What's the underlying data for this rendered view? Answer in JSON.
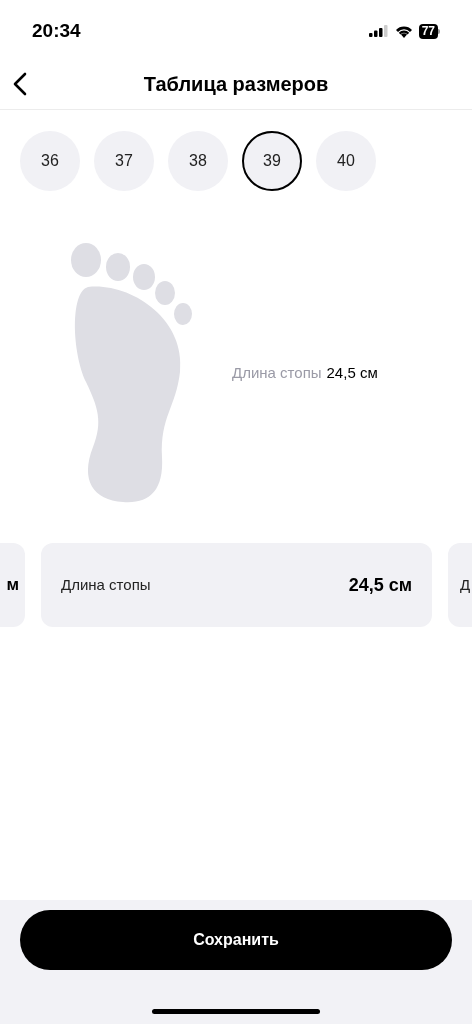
{
  "status_bar": {
    "time": "20:34",
    "battery": "77"
  },
  "header": {
    "title": "Таблица размеров"
  },
  "sizes": [
    {
      "label": "36",
      "selected": false
    },
    {
      "label": "37",
      "selected": false
    },
    {
      "label": "38",
      "selected": false
    },
    {
      "label": "39",
      "selected": true
    },
    {
      "label": "40",
      "selected": false
    }
  ],
  "foot": {
    "label": "Длина стопы",
    "value": "24,5 см"
  },
  "cards": [
    {
      "kind": "partial_left",
      "value": "м"
    },
    {
      "kind": "full",
      "label": "Длина стопы",
      "value": "24,5 см"
    },
    {
      "kind": "partial_right",
      "label": "Д"
    }
  ],
  "save_button": "Сохранить"
}
